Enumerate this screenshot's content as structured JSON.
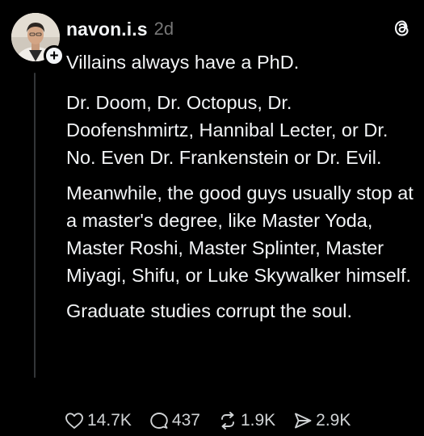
{
  "post": {
    "username": "navon.i.s",
    "timestamp": "2d",
    "paragraphs": [
      "Villains always have a PhD.",
      "Dr. Doom, Dr. Octopus, Dr. Doofenshmirtz, Hannibal Lecter, or Dr. No. Even Dr. Frankenstein or Dr. Evil.",
      "Meanwhile, the good guys usually stop at a master's degree, like Master Yoda, Master Roshi, Master Splinter, Master Miyagi, Shifu, or Luke Skywalker himself.",
      "Graduate studies corrupt the soul."
    ],
    "follow_badge": "+"
  },
  "actions": {
    "likes": "14.7K",
    "replies": "437",
    "reposts": "1.9K",
    "shares": "2.9K"
  },
  "icons": {
    "like": "heart-icon",
    "reply": "speech-bubble-icon",
    "repost": "repost-icon",
    "share": "send-icon",
    "app": "threads-logo-icon"
  },
  "colors": {
    "background": "#000000",
    "text": "#f3f5f7",
    "muted": "#777777"
  }
}
